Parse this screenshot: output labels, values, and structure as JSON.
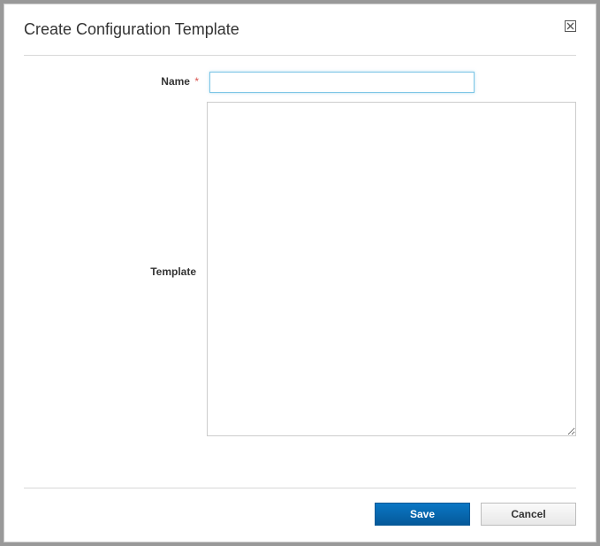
{
  "dialog": {
    "title": "Create Configuration Template",
    "close_glyph": "⊠"
  },
  "form": {
    "name": {
      "label": "Name",
      "required_marker": "*",
      "value": ""
    },
    "template": {
      "label": "Template",
      "value": ""
    }
  },
  "footer": {
    "save_label": "Save",
    "cancel_label": "Cancel"
  }
}
